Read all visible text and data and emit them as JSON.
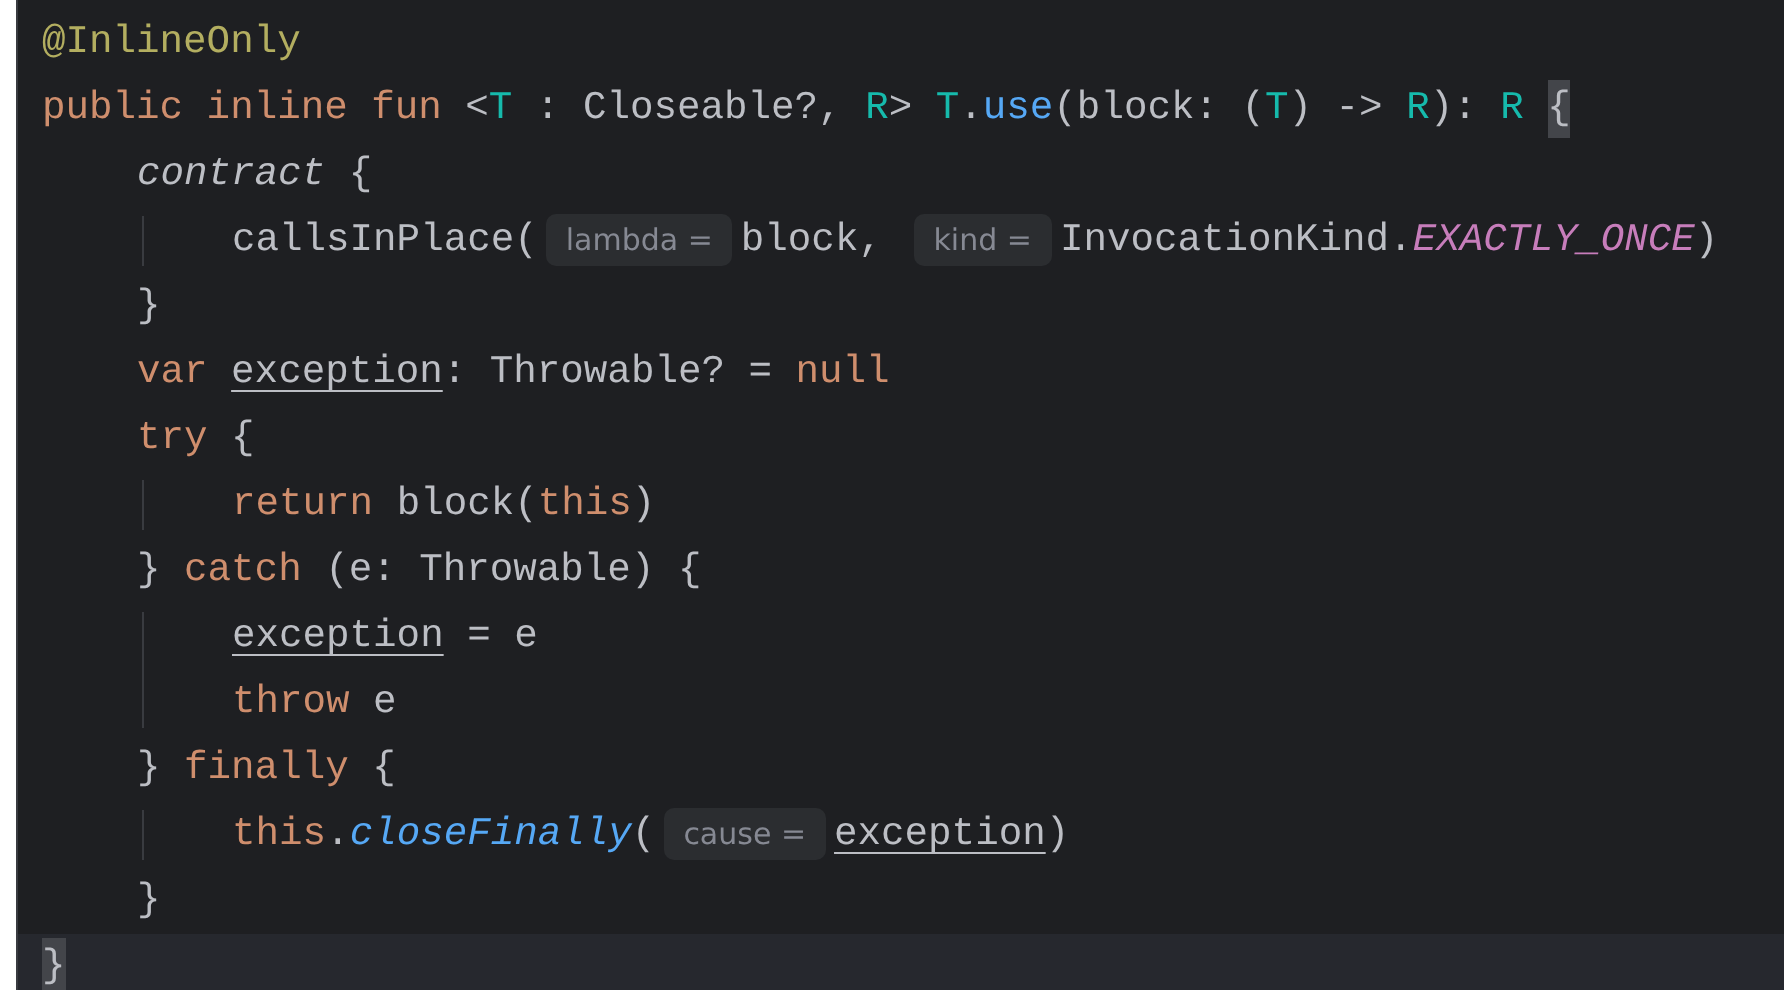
{
  "lines": [
    {
      "current": false,
      "tokens": [
        {
          "kind": "annotation",
          "text": "@InlineOnly"
        }
      ]
    },
    {
      "current": false,
      "tokens": [
        {
          "kind": "keyword",
          "text": "public inline fun "
        },
        {
          "kind": "text",
          "text": "<"
        },
        {
          "kind": "type_param",
          "text": "T"
        },
        {
          "kind": "text",
          "text": " : Closeable?, "
        },
        {
          "kind": "type_param",
          "text": "R"
        },
        {
          "kind": "text",
          "text": "> "
        },
        {
          "kind": "type_param",
          "text": "T"
        },
        {
          "kind": "text",
          "text": "."
        },
        {
          "kind": "function",
          "text": "use"
        },
        {
          "kind": "text",
          "text": "(block: ("
        },
        {
          "kind": "type_param",
          "text": "T"
        },
        {
          "kind": "text",
          "text": ") -> "
        },
        {
          "kind": "type_param",
          "text": "R"
        },
        {
          "kind": "text",
          "text": "): "
        },
        {
          "kind": "type_param",
          "text": "R "
        },
        {
          "kind": "brace_match",
          "text": "{"
        }
      ],
      "children": [
        {
          "current": false,
          "tokens": [
            {
              "kind": "italic_text",
              "text": "contract"
            },
            {
              "kind": "text",
              "text": " {"
            }
          ],
          "children": [
            {
              "current": false,
              "tokens": [
                {
                  "kind": "text",
                  "text": "callsInPlace("
                },
                {
                  "kind": "hint",
                  "text": "lambda ="
                },
                {
                  "kind": "text",
                  "text": "block, "
                },
                {
                  "kind": "hint",
                  "text": "kind ="
                },
                {
                  "kind": "text",
                  "text": "InvocationKind."
                },
                {
                  "kind": "constant",
                  "text": "EXACTLY_ONCE"
                },
                {
                  "kind": "text",
                  "text": ")"
                }
              ]
            }
          ]
        },
        {
          "current": false,
          "tokens": [
            {
              "kind": "text",
              "text": "}"
            }
          ]
        },
        {
          "current": false,
          "tokens": [
            {
              "kind": "keyword",
              "text": "var "
            },
            {
              "kind": "variable",
              "text": "exception"
            },
            {
              "kind": "text",
              "text": ": Throwable? = "
            },
            {
              "kind": "keyword",
              "text": "null"
            }
          ]
        },
        {
          "current": false,
          "tokens": [
            {
              "kind": "keyword",
              "text": "try"
            },
            {
              "kind": "text",
              "text": " {"
            }
          ],
          "children": [
            {
              "current": false,
              "tokens": [
                {
                  "kind": "keyword",
                  "text": "return"
                },
                {
                  "kind": "text",
                  "text": " block("
                },
                {
                  "kind": "keyword",
                  "text": "this"
                },
                {
                  "kind": "text",
                  "text": ")"
                }
              ]
            }
          ]
        },
        {
          "current": false,
          "tokens": [
            {
              "kind": "text",
              "text": "} "
            },
            {
              "kind": "keyword",
              "text": "catch"
            },
            {
              "kind": "text",
              "text": " (e: Throwable) {"
            }
          ],
          "children": [
            {
              "current": false,
              "tokens": [
                {
                  "kind": "variable",
                  "text": "exception"
                },
                {
                  "kind": "text",
                  "text": " = e"
                }
              ]
            },
            {
              "current": false,
              "tokens": [
                {
                  "kind": "keyword",
                  "text": "throw"
                },
                {
                  "kind": "text",
                  "text": " e"
                }
              ]
            }
          ]
        },
        {
          "current": false,
          "tokens": [
            {
              "kind": "text",
              "text": "} "
            },
            {
              "kind": "keyword",
              "text": "finally"
            },
            {
              "kind": "text",
              "text": " {"
            }
          ],
          "children": [
            {
              "current": false,
              "tokens": [
                {
                  "kind": "keyword",
                  "text": "this"
                },
                {
                  "kind": "text",
                  "text": "."
                },
                {
                  "kind": "italic_function",
                  "text": "closeFinally"
                },
                {
                  "kind": "text",
                  "text": "("
                },
                {
                  "kind": "hint",
                  "text": "cause ="
                },
                {
                  "kind": "variable",
                  "text": "exception"
                },
                {
                  "kind": "text",
                  "text": ")"
                }
              ]
            }
          ]
        },
        {
          "current": false,
          "tokens": [
            {
              "kind": "text",
              "text": "}"
            }
          ]
        }
      ]
    },
    {
      "current": true,
      "tokens": [
        {
          "kind": "brace_match",
          "text": "}"
        }
      ]
    }
  ]
}
